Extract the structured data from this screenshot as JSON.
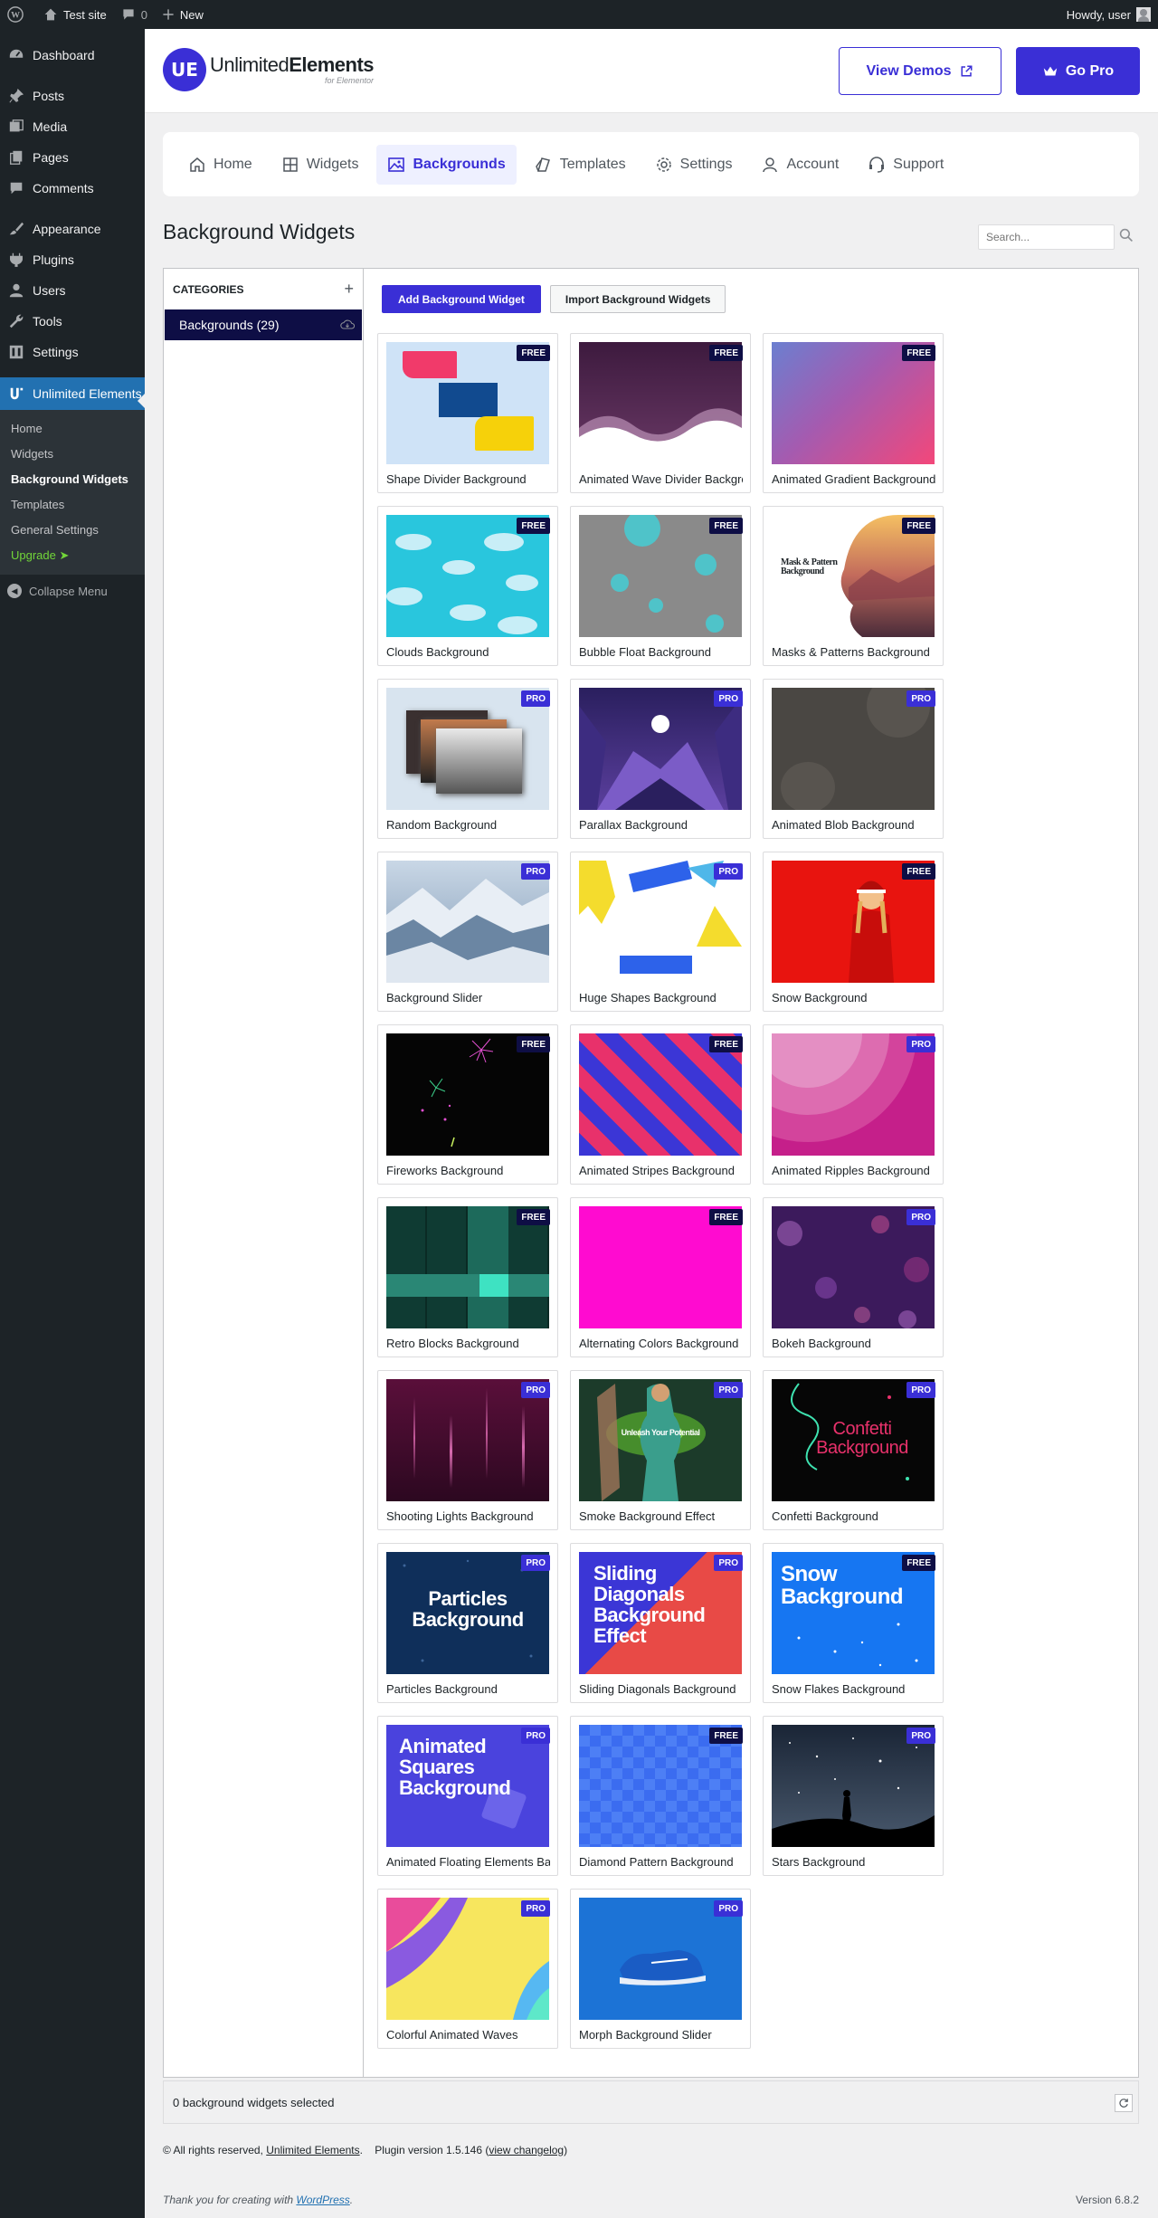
{
  "adminbar": {
    "site": "Test site",
    "comments": "0",
    "new": "New",
    "howdy": "Howdy, user"
  },
  "sidebar": {
    "items": [
      {
        "label": "Dashboard"
      },
      {
        "label": "Posts"
      },
      {
        "label": "Media"
      },
      {
        "label": "Pages"
      },
      {
        "label": "Comments"
      },
      {
        "label": "Appearance"
      },
      {
        "label": "Plugins"
      },
      {
        "label": "Users"
      },
      {
        "label": "Tools"
      },
      {
        "label": "Settings"
      }
    ],
    "active": "Unlimited Elements",
    "submenu": [
      "Home",
      "Widgets",
      "Background Widgets",
      "Templates",
      "General Settings",
      "Upgrade ➤"
    ],
    "collapse": "Collapse Menu"
  },
  "header": {
    "logo_main": "Unlimited",
    "logo_bold": "Elements",
    "logo_sub": "for Elementor",
    "view_demos": "View Demos",
    "go_pro": "Go Pro"
  },
  "tabs": [
    "Home",
    "Widgets",
    "Backgrounds",
    "Templates",
    "Settings",
    "Account",
    "Support"
  ],
  "page": {
    "title": "Background Widgets",
    "search_placeholder": "Search..."
  },
  "categories": {
    "header": "CATEGORIES",
    "item": "Backgrounds (29)"
  },
  "toolbar": {
    "add": "Add Background Widget",
    "import": "Import Background Widgets"
  },
  "widgets": [
    {
      "name": "Shape Divider Background",
      "badge": "FREE"
    },
    {
      "name": "Animated Wave Divider Background",
      "badge": "FREE"
    },
    {
      "name": "Animated Gradient Background",
      "badge": "FREE"
    },
    {
      "name": "Clouds Background",
      "badge": "FREE"
    },
    {
      "name": "Bubble Float Background",
      "badge": "FREE"
    },
    {
      "name": "Masks & Patterns Background",
      "badge": "FREE"
    },
    {
      "name": "Random Background",
      "badge": "PRO"
    },
    {
      "name": "Parallax Background",
      "badge": "PRO"
    },
    {
      "name": "Animated Blob Background",
      "badge": "PRO"
    },
    {
      "name": "Background Slider",
      "badge": "PRO"
    },
    {
      "name": "Huge Shapes Background",
      "badge": "PRO"
    },
    {
      "name": "Snow Background",
      "badge": "FREE"
    },
    {
      "name": "Fireworks Background",
      "badge": "FREE"
    },
    {
      "name": "Animated Stripes Background",
      "badge": "FREE"
    },
    {
      "name": "Animated Ripples Background",
      "badge": "PRO"
    },
    {
      "name": "Retro Blocks Background",
      "badge": "FREE"
    },
    {
      "name": "Alternating Colors Background",
      "badge": "FREE"
    },
    {
      "name": "Bokeh Background",
      "badge": "PRO"
    },
    {
      "name": "Shooting Lights Background",
      "badge": "PRO"
    },
    {
      "name": "Smoke Background Effect",
      "badge": "PRO"
    },
    {
      "name": "Confetti Background",
      "badge": "PRO"
    },
    {
      "name": "Particles Background",
      "badge": "PRO"
    },
    {
      "name": "Sliding Diagonals Background",
      "badge": "PRO"
    },
    {
      "name": "Snow Flakes Background",
      "badge": "FREE"
    },
    {
      "name": "Animated Floating Elements Background",
      "badge": "PRO"
    },
    {
      "name": "Diamond Pattern Background",
      "badge": "FREE"
    },
    {
      "name": "Stars Background",
      "badge": "PRO"
    },
    {
      "name": "Colorful Animated Waves",
      "badge": "PRO"
    },
    {
      "name": "Morph Background Slider",
      "badge": "PRO"
    }
  ],
  "thumb_text": {
    "mask": "Mask & Pattern Background",
    "smoke": "Unleash Your Potential",
    "confetti": "Confetti Background",
    "particles": "Particles Background",
    "sliding": "Sliding Diagonals Background Effect",
    "snowflakes": "Snow Background",
    "floating": "Animated Squares Background"
  },
  "footer": {
    "selected": "0 background widgets selected",
    "copyright": "© All rights reserved,",
    "brand": "Unlimited Elements",
    "plugin": "Plugin version 1.5.146",
    "changelog": "view changelog",
    "thanks": "Thank you for creating with",
    "wp": "WordPress",
    "version": "Version 6.8.2"
  }
}
